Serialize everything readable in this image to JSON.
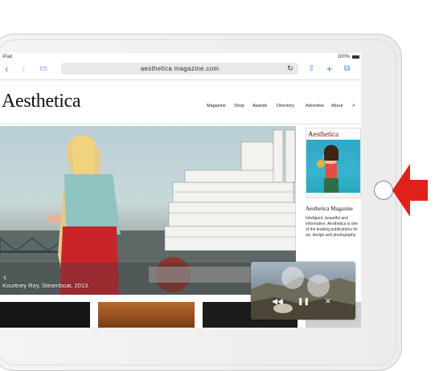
{
  "status_bar": {
    "carrier": "iPad",
    "battery": "100%"
  },
  "browser": {
    "url": "aesthetica magazine.com",
    "icons": [
      "chevron-left-icon",
      "chevron-right-icon",
      "book-icon",
      "reload-icon",
      "share-icon",
      "plus-icon",
      "tabs-icon"
    ]
  },
  "site": {
    "logo": "Aesthetica",
    "nav": [
      "Magazine",
      "Shop",
      "Awards",
      "Directory",
      "Advertise",
      "About"
    ],
    "nav_search_icon": "search-icon",
    "hero_caption": "Kourtney Roy, Steamboat, 2013.",
    "sidebar": {
      "mag_title": "Aesthetica",
      "heading": "Aesthetica Magazine",
      "text": "Intelligent, beautiful and informative, Aesthetica is one of the leading publications for art, design and photography."
    }
  },
  "colors": {
    "accent": "#3b82f6",
    "arrow": "#e0201b"
  }
}
